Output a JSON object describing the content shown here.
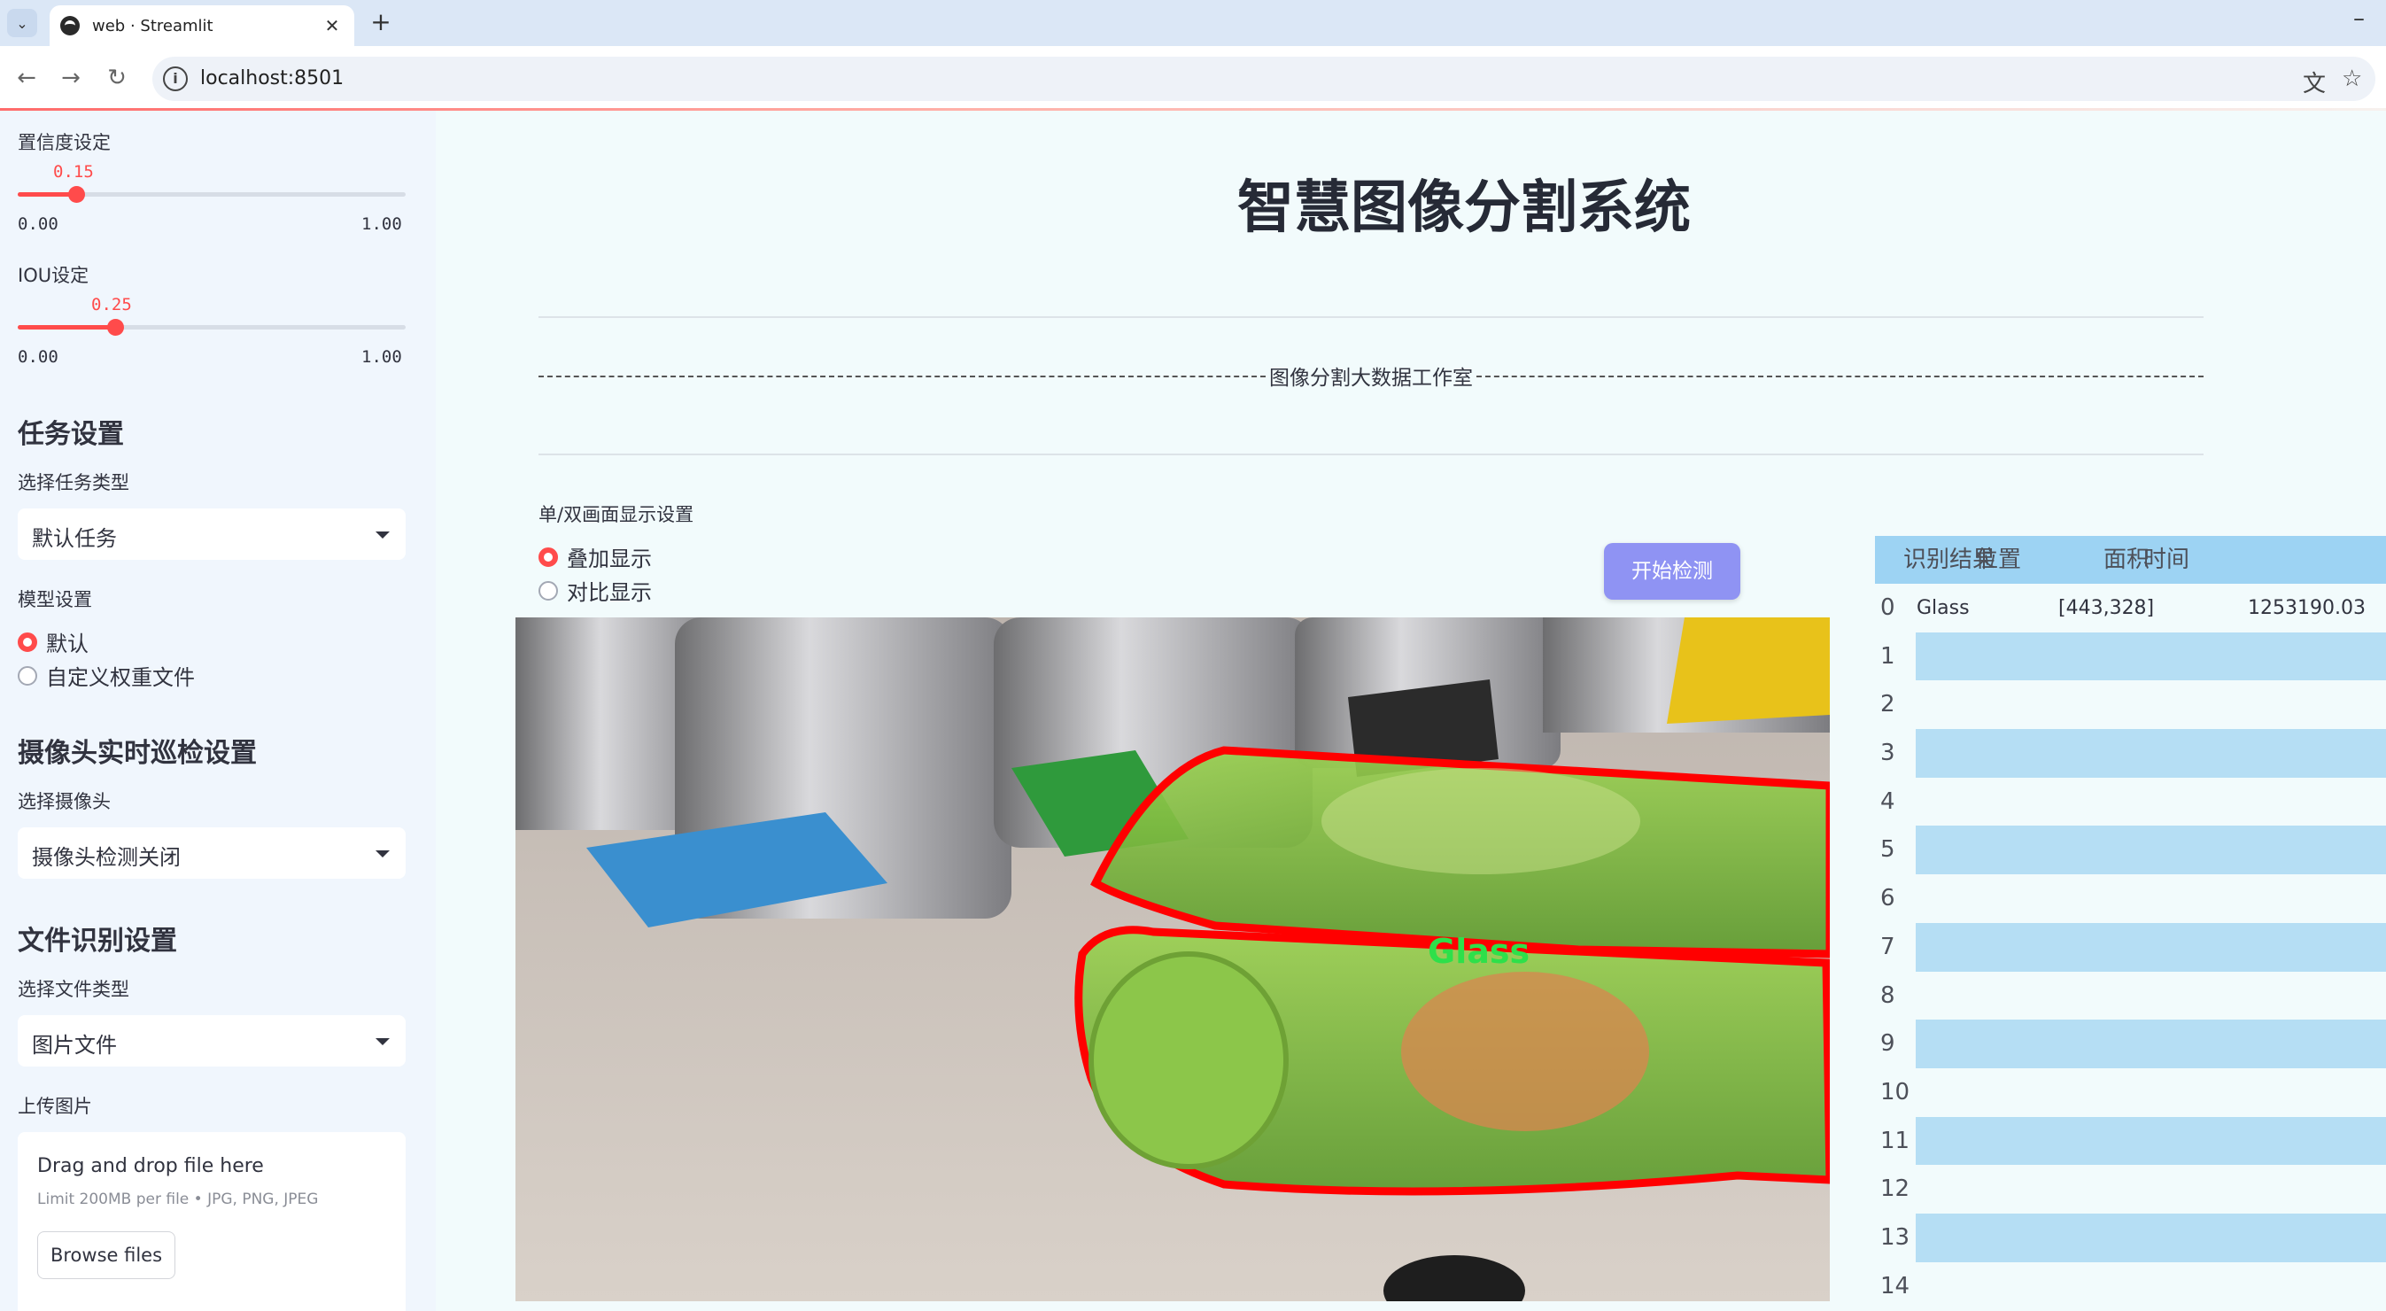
{
  "browser": {
    "tab_title": "web · Streamlit",
    "url": "localhost:8501"
  },
  "sidebar": {
    "confidence": {
      "label": "置信度设定",
      "value": "0.15",
      "min": "0.00",
      "max": "1.00",
      "fraction": 0.15
    },
    "iou": {
      "label": "IOU设定",
      "value": "0.25",
      "min": "0.00",
      "max": "1.00",
      "fraction": 0.25
    },
    "task_heading": "任务设置",
    "task_type_label": "选择任务类型",
    "task_type_value": "默认任务",
    "model_label": "模型设置",
    "model_options": [
      "默认",
      "自定义权重文件"
    ],
    "model_selected": "默认",
    "camera_heading": "摄像头实时巡检设置",
    "camera_label": "选择摄像头",
    "camera_value": "摄像头检测关闭",
    "file_heading": "文件识别设置",
    "file_type_label": "选择文件类型",
    "file_type_value": "图片文件",
    "upload_label": "上传图片",
    "upload_title": "Drag and drop file here",
    "upload_limit": "Limit 200MB per file • JPG, PNG, JPEG",
    "browse_label": "Browse files"
  },
  "main": {
    "title": "智慧图像分割系统",
    "banner": "图像分割大数据工作室",
    "display_label": "单/双画面显示设置",
    "display_options": [
      "叠加显示",
      "对比显示"
    ],
    "display_selected": "叠加显示",
    "start_button": "开始检测",
    "detection_label": "Glass"
  },
  "table": {
    "columns": [
      "识别结果",
      "位置",
      "面积",
      "时间"
    ],
    "rows": [
      {
        "index": "0",
        "result": "Glass",
        "position": "[443,328]",
        "area": "125319",
        "time": "0.03"
      },
      {
        "index": "1"
      },
      {
        "index": "2"
      },
      {
        "index": "3"
      },
      {
        "index": "4"
      },
      {
        "index": "5"
      },
      {
        "index": "6"
      },
      {
        "index": "7"
      },
      {
        "index": "8"
      },
      {
        "index": "9"
      },
      {
        "index": "10"
      },
      {
        "index": "11"
      },
      {
        "index": "12"
      },
      {
        "index": "13"
      },
      {
        "index": "14"
      }
    ]
  },
  "colors": {
    "accent": "#ff4b4b",
    "sidebar_bg": "#f0f6fd",
    "main_bg": "#f2fbfc",
    "button": "#8f93f3",
    "table_header": "#9dd3f3",
    "table_stripe": "#b5def4",
    "mask_outline": "#ff0000",
    "mask_fill": "#7ac23a"
  },
  "icons": [
    "chevron-down-icon",
    "close-icon",
    "plus-icon",
    "back-icon",
    "forward-icon",
    "reload-icon",
    "info-icon",
    "translate-icon",
    "star-icon"
  ]
}
